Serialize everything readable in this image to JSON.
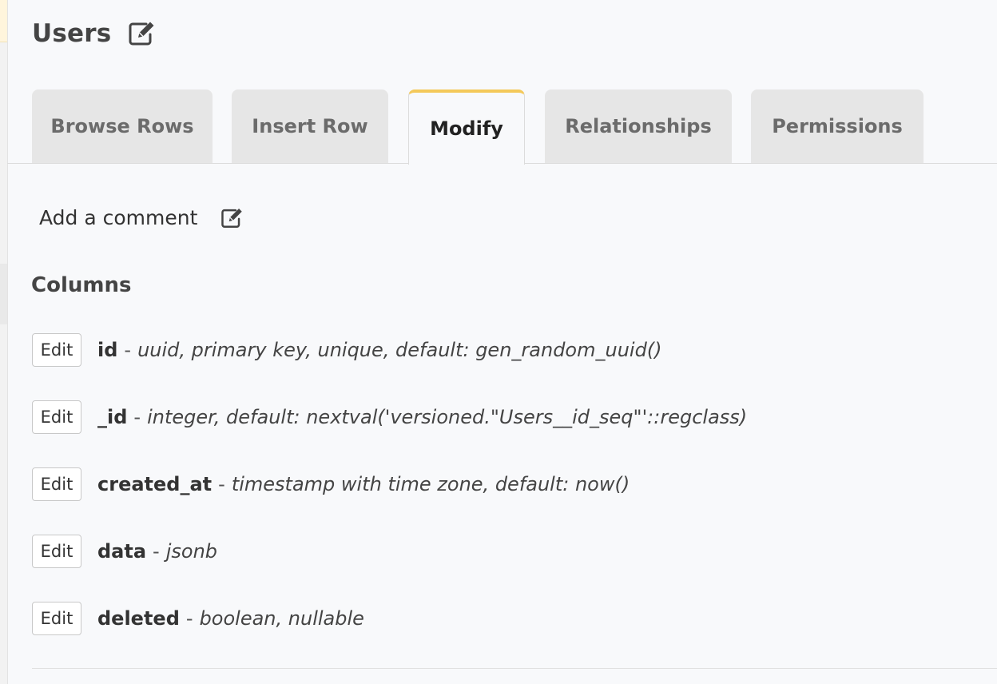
{
  "page": {
    "title": "Users"
  },
  "tabs": [
    {
      "label": "Browse Rows",
      "active": false
    },
    {
      "label": "Insert Row",
      "active": false
    },
    {
      "label": "Modify",
      "active": true
    },
    {
      "label": "Relationships",
      "active": false
    },
    {
      "label": "Permissions",
      "active": false
    }
  ],
  "comment": {
    "label": "Add a comment"
  },
  "columns_section": {
    "heading": "Columns",
    "edit_label": "Edit",
    "separator": "-",
    "rows": [
      {
        "name": "id",
        "type": "uuid, primary key, unique, default: gen_random_uuid()"
      },
      {
        "name": "_id",
        "type": "integer, default: nextval('versioned.\"Users__id_seq\"'::regclass)"
      },
      {
        "name": "created_at",
        "type": "timestamp with time zone, default: now()"
      },
      {
        "name": "data",
        "type": "jsonb"
      },
      {
        "name": "deleted",
        "type": "boolean, nullable"
      }
    ]
  },
  "icons": {
    "title_edit": "edit-icon",
    "comment_edit": "edit-icon"
  },
  "colors": {
    "active_tab_accent": "#f4c95a",
    "tab_background": "#e6e6e6",
    "page_background": "#f8f9fb"
  }
}
